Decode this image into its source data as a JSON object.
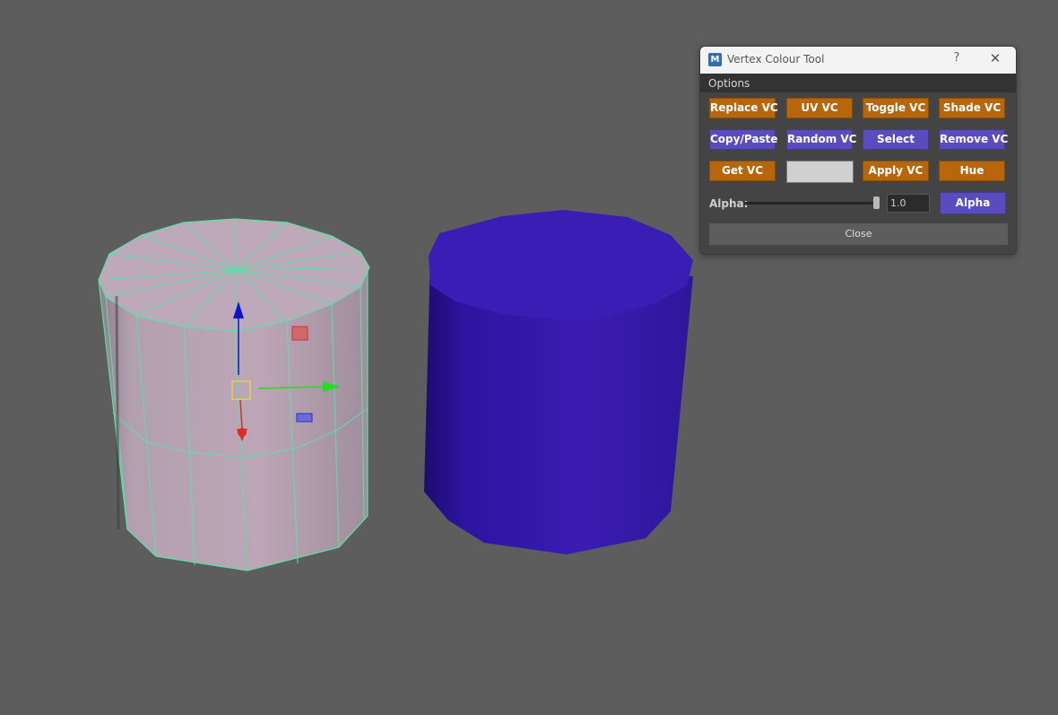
{
  "window": {
    "title": "Vertex Colour Tool",
    "app_icon_text": "M",
    "help_symbol": "?",
    "close_symbol": "✕",
    "menu": {
      "options_label": "Options"
    }
  },
  "buttons": {
    "replace_vc": "Replace VC",
    "uv_vc": "UV VC",
    "toggle_vc": "Toggle VC",
    "shade_vc": "Shade VC",
    "copy_paste": "Copy/Paste",
    "random_vc": "Random VC",
    "select": "Select",
    "remove_vc": "Remove VC",
    "get_vc": "Get VC",
    "apply_vc": "Apply VC",
    "hue": "Hue",
    "alpha": "Alpha",
    "close": "Close"
  },
  "alpha": {
    "label": "Alpha:",
    "value": "1.0",
    "slider_fraction": 1.0
  },
  "colors": {
    "viewport_bg": "#5d5d5d",
    "orange_button": "#b8660c",
    "blue_button": "#5a4cbf",
    "swatch": "#d0d0d0",
    "selected_cylinder": "#b9a2b4",
    "wireframe": "#5de0a6",
    "vertex_colored_cylinder": "#3a1cb2",
    "gizmo_x": "#22dd22",
    "gizmo_y": "#1111dd",
    "gizmo_z": "#e02a2a"
  },
  "scene": {
    "objects": [
      "selected-cylinder-wireframe",
      "vertex-colored-cylinder"
    ],
    "gizmo": "move-tool"
  }
}
